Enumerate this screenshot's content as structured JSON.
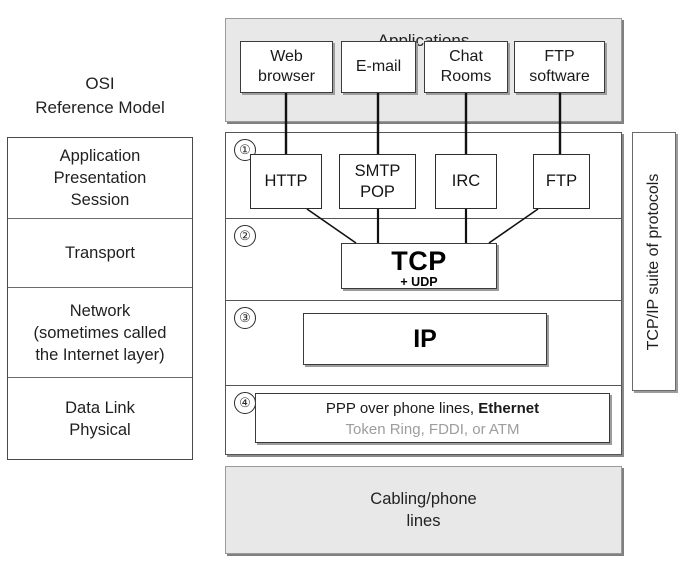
{
  "osi": {
    "title": "OSI\nReference Model",
    "title_line_1": "OSI",
    "title_line_2": "Reference Model",
    "layers": [
      {
        "label": "Application\nPresentation\nSession",
        "lines": [
          "Application",
          "Presentation",
          "Session"
        ]
      },
      {
        "label": "Transport",
        "lines": [
          "Transport"
        ]
      },
      {
        "label": "Network\n(sometimes called\nthe Internet layer)",
        "lines": [
          "Network",
          "(sometimes called",
          "the Internet layer)"
        ]
      },
      {
        "label": "Data Link\nPhysical",
        "lines": [
          "Data Link",
          "Physical"
        ]
      }
    ]
  },
  "applications": {
    "title": "Applications",
    "boxes": [
      {
        "label": "Web\nbrowser",
        "line_1": "Web",
        "line_2": "browser"
      },
      {
        "label": "E-mail",
        "line_1": "E-mail",
        "line_2": ""
      },
      {
        "label": "Chat\nRooms",
        "line_1": "Chat",
        "line_2": "Rooms"
      },
      {
        "label": "FTP\nsoftware",
        "line_1": "FTP",
        "line_2": "software"
      }
    ]
  },
  "suite": {
    "vertical_label": "TCP/IP suite of protocols",
    "layers": [
      {
        "number": "①"
      },
      {
        "number": "②"
      },
      {
        "number": "③"
      },
      {
        "number": "④"
      }
    ],
    "protocols": [
      {
        "label": "HTTP",
        "line_1": "HTTP",
        "line_2": ""
      },
      {
        "label": "SMTP\nPOP",
        "line_1": "SMTP",
        "line_2": "POP"
      },
      {
        "label": "IRC",
        "line_1": "IRC",
        "line_2": ""
      },
      {
        "label": "FTP",
        "line_1": "FTP",
        "line_2": ""
      }
    ],
    "transport": {
      "title": "TCP",
      "subtitle": "+ UDP"
    },
    "internet": {
      "title": "IP"
    },
    "link": {
      "line_1_plain": "PPP over phone lines, ",
      "line_1_bold": "Ethernet",
      "line_2": "Token Ring, FDDI, or ATM"
    }
  },
  "cabling": {
    "label": "Cabling/phone\nlines",
    "line_1": "Cabling/phone",
    "line_2": "lines"
  },
  "colors": {
    "panel_fill": "#e8e8e8",
    "box_fill": "#ffffff",
    "stroke": "#3a3a3a",
    "muted_text": "#9d9d9d",
    "text": "#1a1a1a"
  }
}
